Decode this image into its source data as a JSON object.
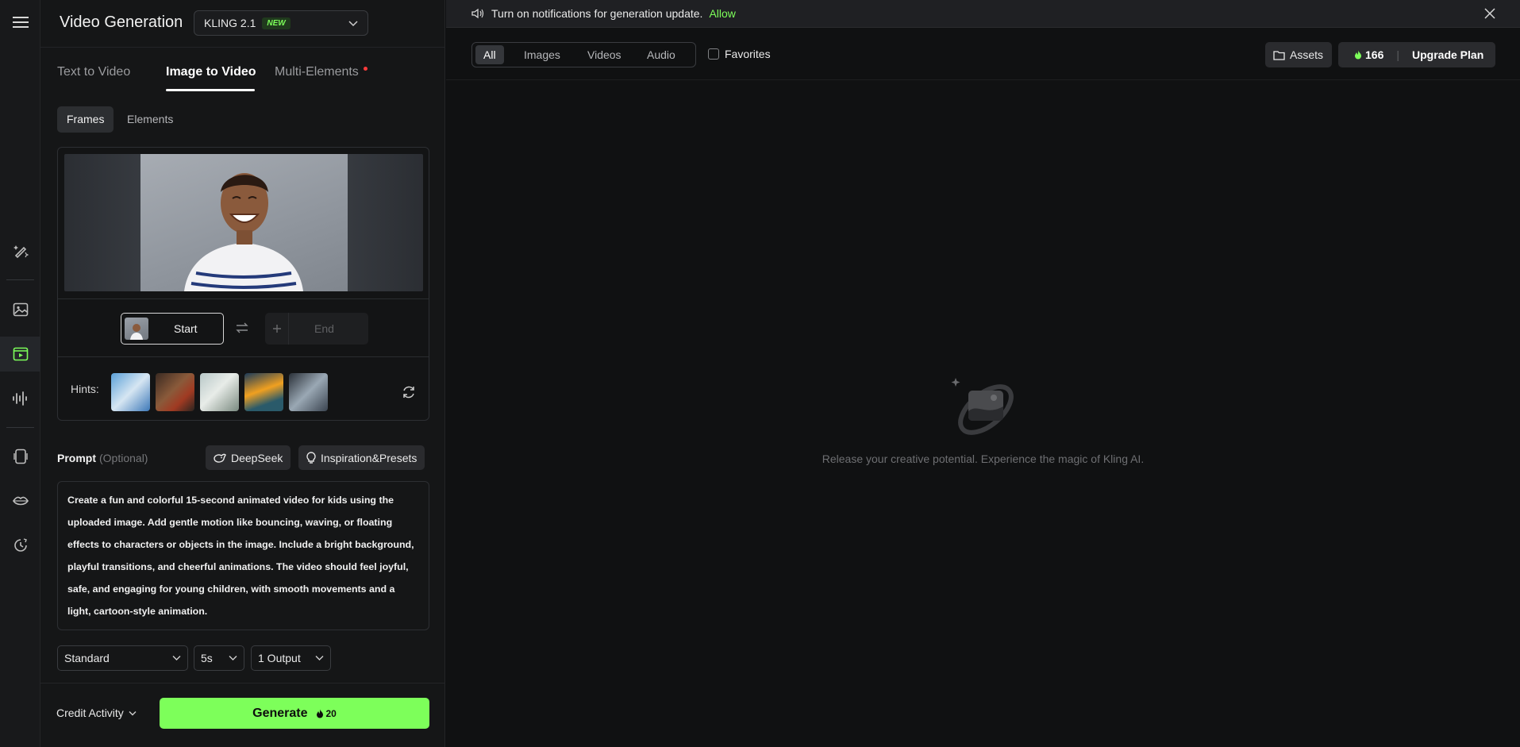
{
  "rail": {
    "icons": [
      "menu-icon",
      "sparkle-pen-icon",
      "image-icon",
      "video-icon",
      "audio-wave-icon",
      "phone-icon",
      "lips-icon",
      "history-icon"
    ],
    "active_color": "#7dff5a"
  },
  "panel": {
    "title": "Video Generation",
    "model": {
      "name": "KLING 2.1",
      "badge": "NEW"
    },
    "tabs": [
      {
        "label": "Text to Video"
      },
      {
        "label": "Image to Video"
      },
      {
        "label": "Multi-Elements"
      }
    ],
    "subtabs": [
      {
        "label": "Frames"
      },
      {
        "label": "Elements"
      }
    ],
    "frames": {
      "start_label": "Start",
      "end_label": "End"
    },
    "hints_label": "Hints:",
    "prompt": {
      "label": "Prompt",
      "optional": "(Optional)",
      "deepseek_label": "DeepSeek",
      "presets_label": "Inspiration&Presets",
      "text": "Create a fun and colorful 15-second animated video for kids using the uploaded image. Add gentle motion like bouncing, waving, or floating effects to characters or objects in the image. Include a bright background, playful transitions, and cheerful animations. The video should feel joyful, safe, and engaging for young children, with smooth movements and a light, cartoon-style animation."
    },
    "options": {
      "mode": "Standard",
      "duration": "5s",
      "outputs": "1 Output"
    },
    "footer": {
      "credit_activity": "Credit Activity",
      "generate_label": "Generate",
      "generate_cost": "20"
    }
  },
  "main": {
    "notification": {
      "text": "Turn on notifications for generation update.",
      "allow": "Allow"
    },
    "filters": [
      {
        "label": "All"
      },
      {
        "label": "Images"
      },
      {
        "label": "Videos"
      },
      {
        "label": "Audio"
      }
    ],
    "favorites_label": "Favorites",
    "assets_label": "Assets",
    "credits": "166",
    "upgrade_label": "Upgrade Plan",
    "empty_text": "Release your creative potential. Experience the magic of Kling AI."
  },
  "colors": {
    "accent": "#7dff5a",
    "background": "#101112",
    "panel": "#151617"
  }
}
